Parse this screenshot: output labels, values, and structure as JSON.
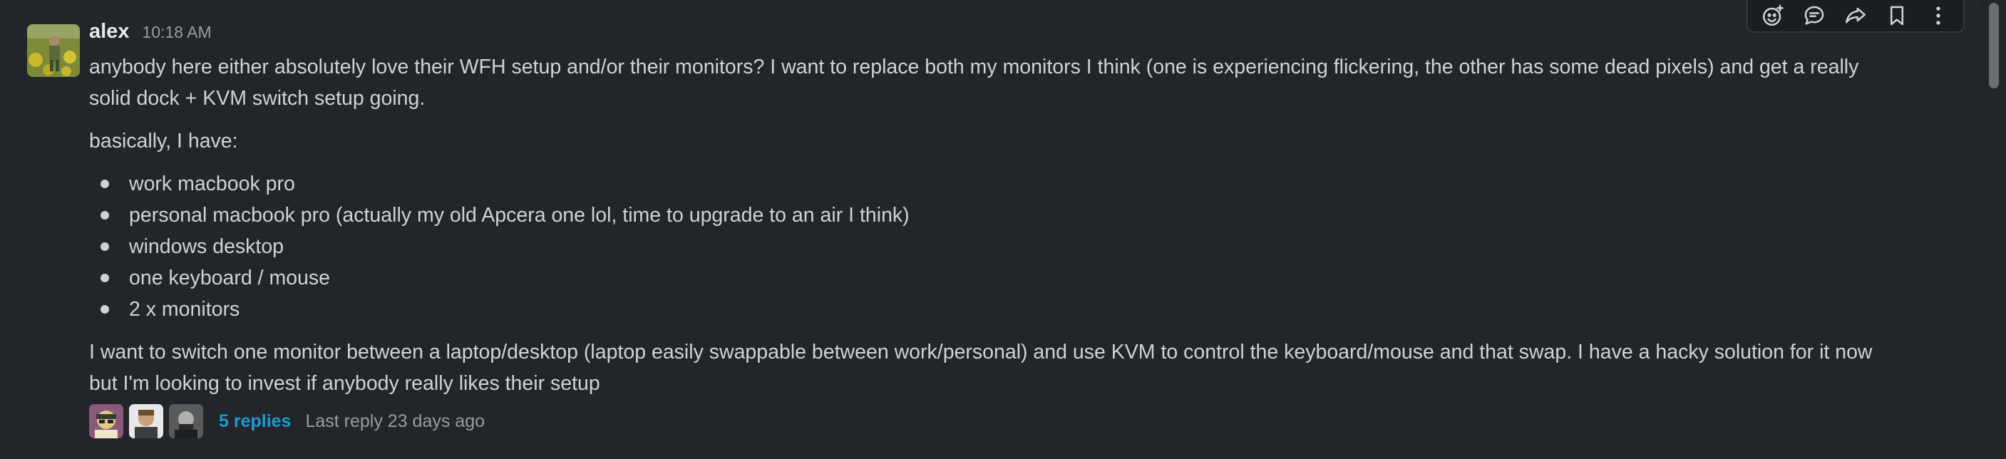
{
  "message": {
    "author": "alex",
    "time": "10:18 AM",
    "paragraph1": "anybody here either absolutely love their WFH setup and/or their monitors? I want to replace both my monitors I think (one is experiencing flickering, the other has some dead pixels) and get a really",
    "paragraph1_cont": "solid dock + KVM switch setup going.",
    "paragraph2": "basically, I have:",
    "list_items": [
      "work macbook pro",
      "personal macbook pro (actually my old Apcera one lol, time to upgrade to an air I think)",
      "windows desktop",
      "one keyboard / mouse",
      "2 x monitors"
    ],
    "paragraph3": "I want to switch one monitor between a laptop/desktop (laptop easily swappable between work/personal) and use KVM to control the keyboard/mouse and that swap. I have a hacky solution for it now",
    "paragraph3_cont": "but I'm looking to invest if anybody really likes their setup"
  },
  "thread": {
    "replies_label": "5 replies",
    "last_reply": "Last reply 23 days ago",
    "participants": [
      "participant-1",
      "participant-2",
      "participant-3"
    ]
  },
  "actions": [
    {
      "name": "add-reaction-icon"
    },
    {
      "name": "reply-in-thread-icon"
    },
    {
      "name": "share-message-icon"
    },
    {
      "name": "save-bookmark-icon"
    },
    {
      "name": "more-actions-icon"
    }
  ],
  "colors": {
    "background": "#222529",
    "link": "#1d9bd1",
    "text": "#d1d2d3",
    "muted": "#9a9b9e"
  }
}
